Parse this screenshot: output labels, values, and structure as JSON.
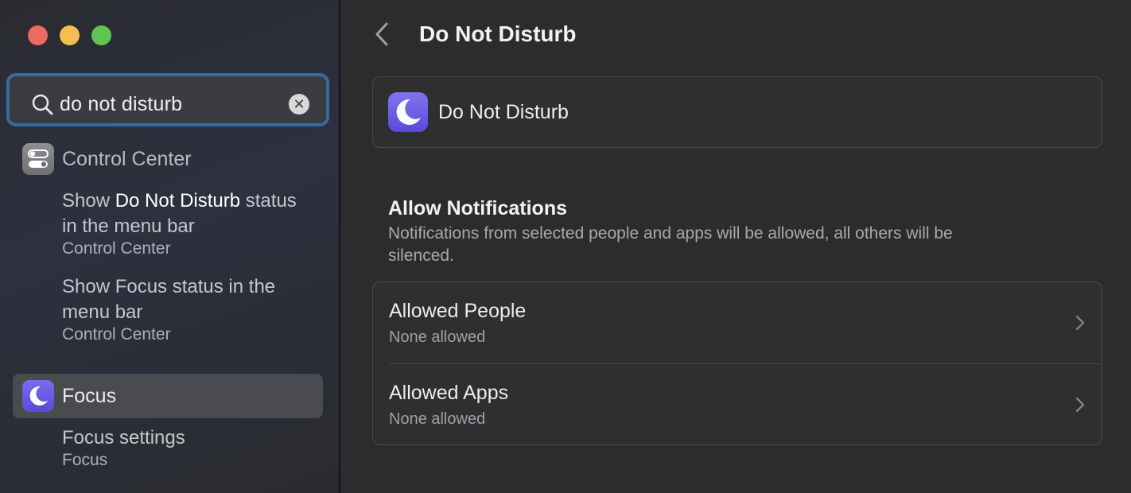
{
  "window": {
    "traffic_lights": [
      "close",
      "minimize",
      "zoom"
    ]
  },
  "sidebar": {
    "search": {
      "value": "do not disturb",
      "clear_symbol": "✕"
    },
    "groups": [
      {
        "title": "Control Center",
        "icon": "toggle-switches-icon",
        "items": [
          {
            "prefix": "Show ",
            "highlight": "Do Not Disturb",
            "suffix": " status in the menu bar",
            "location": "Control Center"
          },
          {
            "prefix": "Show Focus status in the menu bar",
            "highlight": "",
            "suffix": "",
            "location": "Control Center"
          }
        ]
      },
      {
        "title": "Focus",
        "icon": "moon-icon",
        "selected": true,
        "items": [
          {
            "prefix": "Focus settings",
            "highlight": "",
            "suffix": "",
            "location": "Focus"
          }
        ]
      }
    ]
  },
  "main": {
    "title": "Do Not Disturb",
    "header_card": {
      "label": "Do Not Disturb",
      "icon": "moon-icon"
    },
    "allow_section": {
      "title": "Allow Notifications",
      "description": "Notifications from selected people and apps will be allowed, all others will be silenced."
    },
    "list": [
      {
        "title": "Allowed People",
        "subtitle": "None allowed"
      },
      {
        "title": "Allowed Apps",
        "subtitle": "None allowed"
      }
    ]
  },
  "colors": {
    "focus_accent": "#6c5ce7",
    "search_focus_ring": "#3b6a9a",
    "traffic_red": "#ed6a5e",
    "traffic_yellow": "#f5bf4f",
    "traffic_green": "#61c554"
  }
}
